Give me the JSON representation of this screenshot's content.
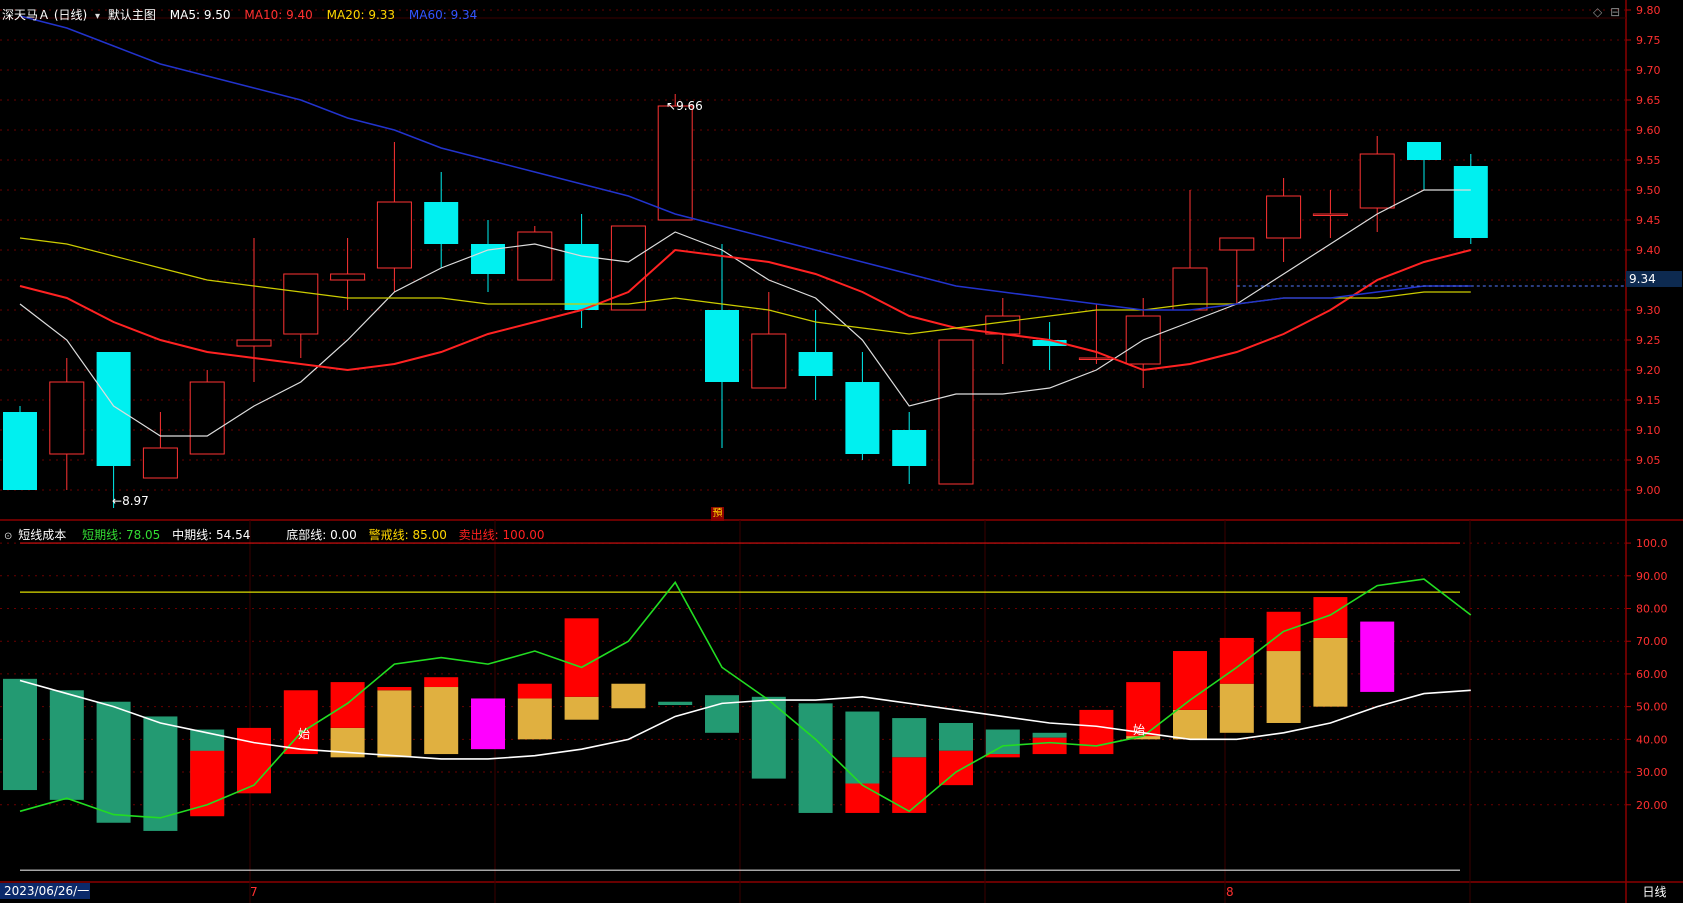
{
  "header": {
    "stock_name": "深天马Ａ",
    "period": "(日线)",
    "default_label": "默认主图",
    "ma": [
      {
        "label": "MA5:",
        "value": "9.50",
        "color": "#ffffff"
      },
      {
        "label": "MA10:",
        "value": "9.40",
        "color": "#ff3030"
      },
      {
        "label": "MA20:",
        "value": "9.33",
        "color": "#ffd700"
      },
      {
        "label": "MA60:",
        "value": "9.34",
        "color": "#2b5bff"
      }
    ],
    "icons": [
      "diamond-icon",
      "collapse-icon"
    ]
  },
  "indicator": {
    "name": "短线成本",
    "lines": [
      {
        "label": "短期线:",
        "value": "78.05",
        "color": "#33dd33"
      },
      {
        "label": "中期线:",
        "value": "54.54",
        "color": "#ffffff"
      },
      {
        "label": "底部线:",
        "value": "0.00",
        "color": "#ffffff"
      },
      {
        "label": "警戒线:",
        "value": "85.00",
        "color": "#ffd700"
      },
      {
        "label": "卖出线:",
        "value": "100.00",
        "color": "#ff2020"
      }
    ],
    "start_label": "始",
    "icons": [
      "indicator-toggle-icon"
    ]
  },
  "colors": {
    "up": "#ff3333",
    "down": "#00f0f0",
    "green_bar": "#239a72",
    "gold_bar": "#e0b040",
    "magenta_bar": "#ff00ff",
    "ma5": "#dddddd",
    "ma10": "#ff2222",
    "ma20": "#cccc00",
    "ma60": "#2233cc"
  },
  "annotations": {
    "high": "9.66",
    "low": "8.97",
    "forecast": "預",
    "current": "9.34"
  },
  "footer": {
    "date": "2023/06/26/一",
    "month7": "7",
    "month8": "8",
    "period_button": "日线"
  },
  "chart_data": [
    {
      "type": "candlestick",
      "title": "深天马Ａ (日线)",
      "y_ticks": [
        "9.80",
        "9.75",
        "9.70",
        "9.65",
        "9.60",
        "9.55",
        "9.50",
        "9.45",
        "9.40",
        "9.35",
        "9.30",
        "9.25",
        "9.20",
        "9.15",
        "9.10",
        "9.05",
        "9.00"
      ],
      "ylim": [
        8.95,
        9.81
      ],
      "candles": [
        {
          "o": 9.13,
          "h": 9.14,
          "l": 9.0,
          "c": 9.0
        },
        {
          "o": 9.06,
          "h": 9.22,
          "l": 9.0,
          "c": 9.18
        },
        {
          "o": 9.23,
          "h": 9.23,
          "l": 8.97,
          "c": 9.04
        },
        {
          "o": 9.02,
          "h": 9.13,
          "l": 9.02,
          "c": 9.07
        },
        {
          "o": 9.06,
          "h": 9.2,
          "l": 9.06,
          "c": 9.18
        },
        {
          "o": 9.24,
          "h": 9.42,
          "l": 9.18,
          "c": 9.25
        },
        {
          "o": 9.26,
          "h": 9.36,
          "l": 9.22,
          "c": 9.36
        },
        {
          "o": 9.35,
          "h": 9.42,
          "l": 9.3,
          "c": 9.36
        },
        {
          "o": 9.37,
          "h": 9.58,
          "l": 9.33,
          "c": 9.48
        },
        {
          "o": 9.48,
          "h": 9.53,
          "l": 9.37,
          "c": 9.41
        },
        {
          "o": 9.41,
          "h": 9.45,
          "l": 9.33,
          "c": 9.36
        },
        {
          "o": 9.35,
          "h": 9.44,
          "l": 9.35,
          "c": 9.43
        },
        {
          "o": 9.41,
          "h": 9.46,
          "l": 9.27,
          "c": 9.3
        },
        {
          "o": 9.3,
          "h": 9.44,
          "l": 9.3,
          "c": 9.44
        },
        {
          "o": 9.45,
          "h": 9.66,
          "l": 9.45,
          "c": 9.64
        },
        {
          "o": 9.3,
          "h": 9.41,
          "l": 9.07,
          "c": 9.18
        },
        {
          "o": 9.17,
          "h": 9.33,
          "l": 9.17,
          "c": 9.26
        },
        {
          "o": 9.23,
          "h": 9.3,
          "l": 9.15,
          "c": 9.19
        },
        {
          "o": 9.18,
          "h": 9.23,
          "l": 9.05,
          "c": 9.06
        },
        {
          "o": 9.1,
          "h": 9.13,
          "l": 9.01,
          "c": 9.04
        },
        {
          "o": 9.01,
          "h": 9.25,
          "l": 9.01,
          "c": 9.25
        },
        {
          "o": 9.26,
          "h": 9.32,
          "l": 9.21,
          "c": 9.29
        },
        {
          "o": 9.25,
          "h": 9.28,
          "l": 9.2,
          "c": 9.24
        },
        {
          "o": 9.22,
          "h": 9.31,
          "l": 9.21,
          "c": 9.22
        },
        {
          "o": 9.21,
          "h": 9.32,
          "l": 9.17,
          "c": 9.29
        },
        {
          "o": 9.3,
          "h": 9.5,
          "l": 9.3,
          "c": 9.37
        },
        {
          "o": 9.4,
          "h": 9.42,
          "l": 9.31,
          "c": 9.42
        },
        {
          "o": 9.42,
          "h": 9.52,
          "l": 9.38,
          "c": 9.49
        },
        {
          "o": 9.46,
          "h": 9.5,
          "l": 9.42,
          "c": 9.46
        },
        {
          "o": 9.47,
          "h": 9.59,
          "l": 9.43,
          "c": 9.56
        },
        {
          "o": 9.58,
          "h": 9.58,
          "l": 9.5,
          "c": 9.55
        },
        {
          "o": 9.54,
          "h": 9.56,
          "l": 9.41,
          "c": 9.42
        }
      ],
      "series": [
        {
          "name": "MA5",
          "values": [
            9.31,
            9.25,
            9.14,
            9.09,
            9.09,
            9.14,
            9.18,
            9.25,
            9.33,
            9.37,
            9.4,
            9.41,
            9.39,
            9.38,
            9.43,
            9.4,
            9.35,
            9.32,
            9.25,
            9.14,
            9.16,
            9.16,
            9.17,
            9.2,
            9.25,
            9.28,
            9.31,
            9.36,
            9.41,
            9.46,
            9.5,
            9.5
          ]
        },
        {
          "name": "MA10",
          "values": [
            9.34,
            9.32,
            9.28,
            9.25,
            9.23,
            9.22,
            9.21,
            9.2,
            9.21,
            9.23,
            9.26,
            9.28,
            9.3,
            9.33,
            9.4,
            9.39,
            9.38,
            9.36,
            9.33,
            9.29,
            9.27,
            9.26,
            9.25,
            9.23,
            9.2,
            9.21,
            9.23,
            9.26,
            9.3,
            9.35,
            9.38,
            9.4
          ]
        },
        {
          "name": "MA20",
          "values": [
            9.42,
            9.41,
            9.39,
            9.37,
            9.35,
            9.34,
            9.33,
            9.32,
            9.32,
            9.32,
            9.31,
            9.31,
            9.31,
            9.31,
            9.32,
            9.31,
            9.3,
            9.28,
            9.27,
            9.26,
            9.27,
            9.28,
            9.29,
            9.3,
            9.3,
            9.31,
            9.31,
            9.32,
            9.32,
            9.32,
            9.33,
            9.33
          ]
        },
        {
          "name": "MA60",
          "values": [
            9.79,
            9.77,
            9.74,
            9.71,
            9.69,
            9.67,
            9.65,
            9.62,
            9.6,
            9.57,
            9.55,
            9.53,
            9.51,
            9.49,
            9.46,
            9.44,
            9.42,
            9.4,
            9.38,
            9.36,
            9.34,
            9.33,
            9.32,
            9.31,
            9.3,
            9.3,
            9.31,
            9.32,
            9.32,
            9.33,
            9.34,
            9.34
          ]
        }
      ]
    },
    {
      "type": "bar",
      "title": "短线成本",
      "y_ticks": [
        "100.0",
        "90.00",
        "80.00",
        "70.00",
        "60.00",
        "50.00",
        "40.00",
        "30.00",
        "20.00"
      ],
      "ylim": [
        -3,
        104
      ],
      "reference_lines": [
        {
          "name": "警戒线",
          "value": 85.0
        },
        {
          "name": "卖出线",
          "value": 100.0
        },
        {
          "name": "底部线",
          "value": 0.0
        }
      ],
      "bars": [
        {
          "color": "green",
          "from": 24.5,
          "to": 58.5
        },
        {
          "color": "green",
          "from": 21.5,
          "to": 55.0
        },
        {
          "color": "green",
          "from": 14.5,
          "to": 51.5
        },
        {
          "color": "green",
          "from": 12.0,
          "to": 47.0
        },
        {
          "color": "green",
          "from": 17.0,
          "to": 43.0
        },
        {
          "color": "green",
          "from": 24.0,
          "to": 39.0
        },
        {
          "color": "green",
          "from": 36.5,
          "to": 37.5
        },
        {
          "color": "red",
          "from": 16.5,
          "to": 36.5
        },
        {
          "color": "red",
          "from": 23.5,
          "to": 43.5
        },
        {
          "color": "red",
          "from": 35.5,
          "to": 55.0
        },
        {
          "color": "gold",
          "from": 34.5,
          "to": 43.5
        },
        {
          "color": "red",
          "from": 43.5,
          "to": 57.5
        },
        {
          "color": "gold",
          "from": 34.5,
          "to": 55.0
        },
        {
          "color": "red",
          "from": 55.0,
          "to": 56.0
        },
        {
          "color": "gold",
          "from": 35.5,
          "to": 56.0
        },
        {
          "color": "red",
          "from": 56.0,
          "to": 59.0
        },
        {
          "color": "magenta",
          "from": 37.0,
          "to": 52.5
        },
        {
          "color": "gold",
          "from": 40.0,
          "to": 52.5
        },
        {
          "color": "red",
          "from": 52.5,
          "to": 57.0
        },
        {
          "color": "gold",
          "from": 46.0,
          "to": 53.0
        },
        {
          "color": "red",
          "from": 53.0,
          "to": 77.0
        },
        {
          "color": "gold",
          "from": 49.5,
          "to": 57.0
        },
        {
          "color": "green",
          "from": 50.5,
          "to": 51.5
        },
        {
          "color": "green",
          "from": 42.0,
          "to": 53.5
        },
        {
          "color": "green",
          "from": 28.0,
          "to": 53.0
        },
        {
          "color": "green",
          "from": 17.5,
          "to": 51.0
        },
        {
          "color": "green",
          "from": 26.5,
          "to": 48.5
        },
        {
          "color": "red",
          "from": 17.5,
          "to": 26.5
        },
        {
          "color": "green",
          "from": 34.5,
          "to": 46.5
        },
        {
          "color": "red",
          "from": 17.5,
          "to": 34.5
        },
        {
          "color": "green",
          "from": 36.5,
          "to": 45.0
        },
        {
          "color": "red",
          "from": 26.0,
          "to": 36.5
        },
        {
          "color": "green",
          "from": 35.5,
          "to": 43.0
        },
        {
          "color": "red",
          "from": 34.5,
          "to": 35.5
        },
        {
          "color": "green",
          "from": 40.5,
          "to": 42.0
        },
        {
          "color": "red",
          "from": 35.5,
          "to": 40.5
        },
        {
          "color": "red",
          "from": 35.5,
          "to": 49.0
        },
        {
          "color": "gold",
          "from": 40.0,
          "to": 41.0
        },
        {
          "color": "red",
          "from": 41.0,
          "to": 57.5
        },
        {
          "color": "gold",
          "from": 40.0,
          "to": 49.0
        },
        {
          "color": "red",
          "from": 49.0,
          "to": 67.0
        },
        {
          "color": "gold",
          "from": 42.0,
          "to": 57.0
        },
        {
          "color": "red",
          "from": 57.0,
          "to": 71.0
        },
        {
          "color": "gold",
          "from": 45.0,
          "to": 67.0
        },
        {
          "color": "red",
          "from": 67.0,
          "to": 79.0
        },
        {
          "color": "gold",
          "from": 50.0,
          "to": 71.0
        },
        {
          "color": "red",
          "from": 71.0,
          "to": 83.5
        },
        {
          "color": "magenta",
          "from": 54.5,
          "to": 76.0
        }
      ],
      "bar_slots": [
        0,
        1,
        2,
        3,
        4,
        5,
        6,
        4,
        5,
        6,
        7,
        7,
        8,
        8,
        9,
        9,
        10,
        11,
        11,
        12,
        12,
        13,
        14,
        15,
        16,
        17,
        18,
        18,
        19,
        19,
        20,
        20,
        21,
        21,
        22,
        22,
        23,
        24,
        24,
        25,
        25,
        26,
        26,
        27,
        27,
        28,
        28,
        29
      ],
      "series": [
        {
          "name": "短期线",
          "values": [
            18,
            22,
            17,
            16,
            20,
            26,
            42,
            51,
            63,
            65,
            63,
            67,
            62,
            70,
            88,
            62,
            52,
            40,
            26,
            18,
            30,
            38,
            39,
            38,
            41,
            52,
            62,
            73,
            78,
            87,
            89,
            78
          ]
        },
        {
          "name": "中期线",
          "values": [
            58,
            54,
            50,
            45,
            42,
            39,
            37,
            36,
            35,
            34,
            34,
            35,
            37,
            40,
            47,
            51,
            52,
            52,
            53,
            51,
            49,
            47,
            45,
            44,
            42,
            40,
            40,
            42,
            45,
            50,
            54,
            55
          ]
        }
      ]
    }
  ]
}
